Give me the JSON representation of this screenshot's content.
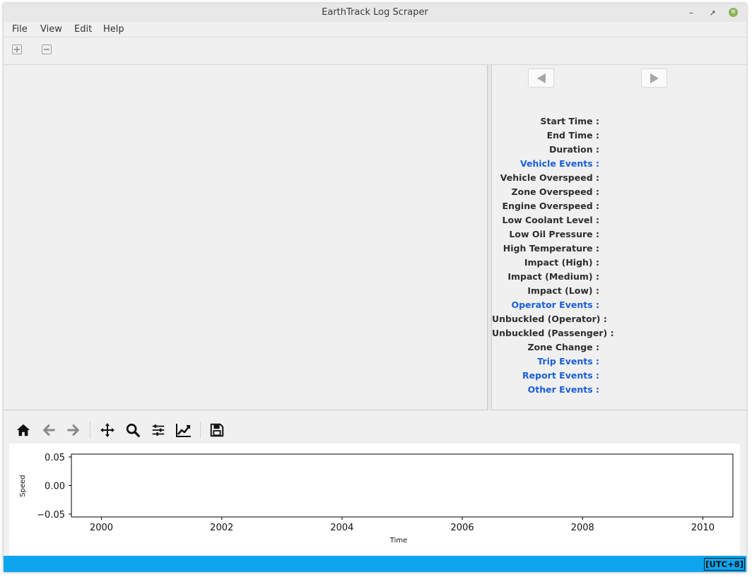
{
  "window": {
    "title": "EarthTrack Log Scraper"
  },
  "menu": [
    "File",
    "View",
    "Edit",
    "Help"
  ],
  "toolbar": {
    "icons": [
      "plus-square-icon",
      "minus-square-icon"
    ]
  },
  "details": {
    "nav": {
      "prev_icon": "triangle-left-icon",
      "next_icon": "triangle-right-icon"
    },
    "fields": [
      {
        "label": "Start Time :",
        "header": false
      },
      {
        "label": "End Time :",
        "header": false
      },
      {
        "label": "Duration :",
        "header": false
      },
      {
        "label": "Vehicle Events :",
        "header": true
      },
      {
        "label": "Vehicle Overspeed :",
        "header": false
      },
      {
        "label": "Zone Overspeed :",
        "header": false
      },
      {
        "label": "Engine Overspeed :",
        "header": false
      },
      {
        "label": "Low Coolant Level :",
        "header": false
      },
      {
        "label": "Low Oil Pressure :",
        "header": false
      },
      {
        "label": "High Temperature :",
        "header": false
      },
      {
        "label": "Impact (High) :",
        "header": false
      },
      {
        "label": "Impact (Medium) :",
        "header": false
      },
      {
        "label": "Impact (Low) :",
        "header": false
      },
      {
        "label": "Operator Events :",
        "header": true
      },
      {
        "label": "Unbuckled (Operator) :",
        "header": false
      },
      {
        "label": "Unbuckled (Passenger) :",
        "header": false
      },
      {
        "label": "Zone Change :",
        "header": false
      },
      {
        "label": "Trip Events :",
        "header": true
      },
      {
        "label": "Report Events :",
        "header": true
      },
      {
        "label": "Other Events :",
        "header": true
      }
    ]
  },
  "plot_toolbar": [
    "home-icon",
    "back-arrow-icon",
    "forward-arrow-icon",
    "pan-icon",
    "zoom-icon",
    "subplots-config-icon",
    "edit-axis-icon",
    "save-icon"
  ],
  "chart_data": {
    "type": "line",
    "series": [],
    "x_ticks": [
      "2000",
      "2002",
      "2004",
      "2006",
      "2008",
      "2010"
    ],
    "y_ticks": [
      "0.05",
      "0.00",
      "−0.05"
    ],
    "xlabel": "Time",
    "ylabel": "Speed",
    "xlim": [
      1999.5,
      2010.5
    ],
    "ylim": [
      -0.055,
      0.055
    ]
  },
  "status": {
    "timezone": "[UTC+8]"
  },
  "colors": {
    "accent": "#1a5fd9",
    "statusbar": "#0fa5ee"
  }
}
